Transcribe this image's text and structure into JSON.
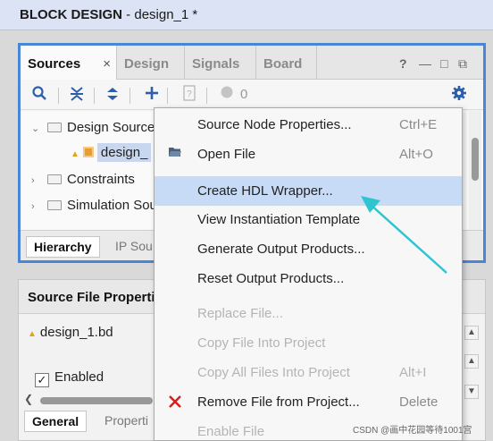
{
  "window": {
    "title_bold": "BLOCK DESIGN",
    "title_rest": " - design_1 *"
  },
  "sources_panel": {
    "tabs": [
      {
        "label": "Sources",
        "active": true
      },
      {
        "label": "Design",
        "active": false
      },
      {
        "label": "Signals",
        "active": false
      },
      {
        "label": "Board",
        "active": false
      }
    ],
    "close_label": "×",
    "help_label": "?",
    "minimize_label": "—",
    "restore_label": "□",
    "float_label": "⧉",
    "toolbar": {
      "search_icon": "search-icon",
      "collapse_icon": "collapse-all-icon",
      "expand_icon": "expand-all-icon",
      "add_icon": "add-icon",
      "help_icon": "question-icon",
      "count": "0",
      "settings_icon": "gear-icon"
    },
    "tree": [
      {
        "label": "Design Source",
        "expanded": true
      },
      {
        "label": "design_",
        "selected": true
      },
      {
        "label": "Constraints",
        "expanded": false
      },
      {
        "label": "Simulation Sou",
        "expanded": false
      }
    ],
    "bottom_tabs": [
      {
        "label": "Hierarchy",
        "active": true
      },
      {
        "label": "IP Sou",
        "active": false
      }
    ]
  },
  "properties_panel": {
    "title": "Source File Properti",
    "file_name": "design_1.bd",
    "enabled_label": "Enabled",
    "enabled_checked": true,
    "checkmark": "✓",
    "tabs": [
      {
        "label": "General",
        "active": true
      },
      {
        "label": "Properti",
        "active": false
      }
    ]
  },
  "context_menu": {
    "items": [
      {
        "label": "Source Node Properties...",
        "shortcut": "Ctrl+E",
        "icon": "",
        "disabled": false,
        "highlighted": false
      },
      {
        "label": "Open File",
        "shortcut": "Alt+O",
        "icon": "folder-open-icon",
        "disabled": false,
        "highlighted": false
      },
      {
        "label": "Create HDL Wrapper...",
        "shortcut": "",
        "icon": "",
        "disabled": false,
        "highlighted": true
      },
      {
        "label": "View Instantiation Template",
        "shortcut": "",
        "icon": "",
        "disabled": false,
        "highlighted": false
      },
      {
        "label": "Generate Output Products...",
        "shortcut": "",
        "icon": "",
        "disabled": false,
        "highlighted": false
      },
      {
        "label": "Reset Output Products...",
        "shortcut": "",
        "icon": "",
        "disabled": false,
        "highlighted": false
      },
      {
        "label": "Replace File...",
        "shortcut": "",
        "icon": "",
        "disabled": true,
        "highlighted": false
      },
      {
        "label": "Copy File Into Project",
        "shortcut": "",
        "icon": "",
        "disabled": true,
        "highlighted": false
      },
      {
        "label": "Copy All Files Into Project",
        "shortcut": "Alt+I",
        "icon": "",
        "disabled": true,
        "highlighted": false
      },
      {
        "label": "Remove File from Project...",
        "shortcut": "Delete",
        "icon": "remove-x-icon",
        "disabled": false,
        "highlighted": false
      },
      {
        "label": "Enable File",
        "shortcut": "",
        "icon": "",
        "disabled": true,
        "highlighted": false
      }
    ]
  },
  "watermark": "CSDN @画中花园等待1001宫",
  "colors": {
    "accent": "#4a86d8",
    "highlight": "#c8dbf6",
    "arrow": "#2fc5cf",
    "remove": "#d62020"
  }
}
